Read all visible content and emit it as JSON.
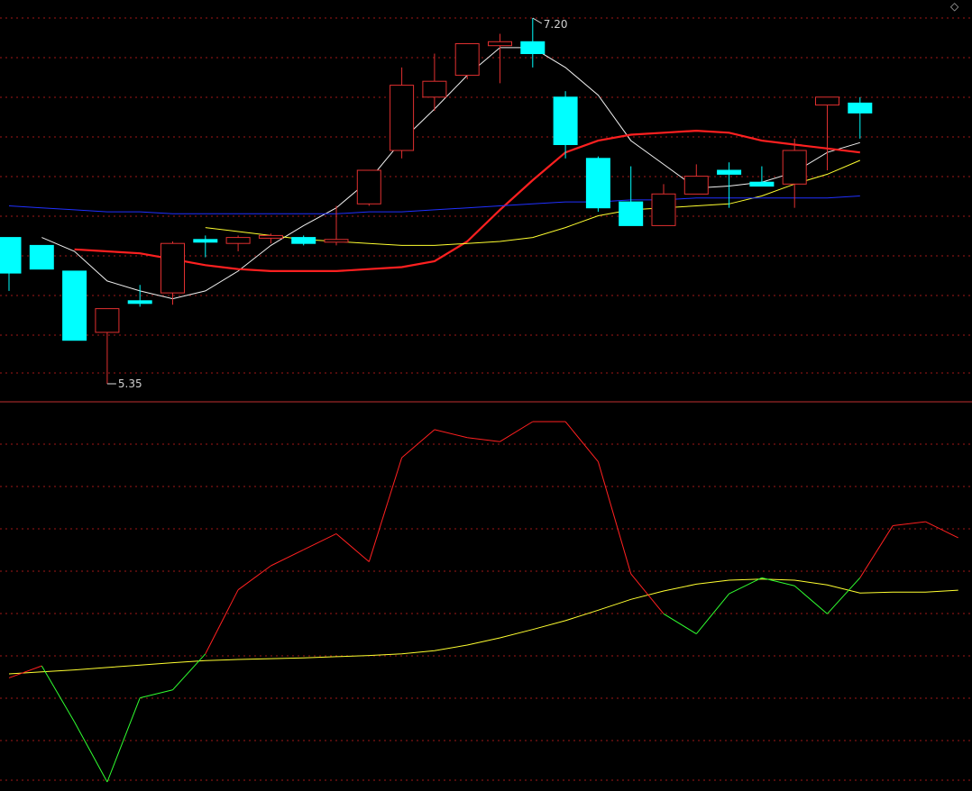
{
  "chart_data": [
    {
      "type": "candlestick",
      "ylim": [
        5.22,
        7.26
      ],
      "high_label": "7.20",
      "low_label": "5.35",
      "high_index": 16,
      "low_index": 3,
      "colors": {
        "up": "#e03030",
        "down": "#00ffff",
        "grid": "#a01818"
      },
      "candles": [
        {
          "o": 6.09,
          "h": 6.09,
          "l": 5.82,
          "c": 5.91
        },
        {
          "o": 6.05,
          "h": 6.05,
          "l": 5.93,
          "c": 5.93
        },
        {
          "o": 5.92,
          "h": 5.92,
          "l": 5.57,
          "c": 5.57
        },
        {
          "o": 5.61,
          "h": 5.63,
          "l": 5.35,
          "c": 5.73
        },
        {
          "o": 5.77,
          "h": 5.85,
          "l": 5.74,
          "c": 5.76
        },
        {
          "o": 5.81,
          "h": 6.07,
          "l": 5.75,
          "c": 6.06
        },
        {
          "o": 6.08,
          "h": 6.1,
          "l": 5.99,
          "c": 6.07
        },
        {
          "o": 6.06,
          "h": 6.1,
          "l": 6.02,
          "c": 6.09
        },
        {
          "o": 6.1,
          "h": 6.11,
          "l": 6.06,
          "c": 6.1
        },
        {
          "o": 6.09,
          "h": 6.1,
          "l": 6.05,
          "c": 6.06
        },
        {
          "o": 6.07,
          "h": 6.25,
          "l": 6.05,
          "c": 6.08
        },
        {
          "o": 6.26,
          "h": 6.43,
          "l": 6.25,
          "c": 6.43
        },
        {
          "o": 6.53,
          "h": 6.95,
          "l": 6.49,
          "c": 6.86
        },
        {
          "o": 6.8,
          "h": 7.02,
          "l": 6.73,
          "c": 6.88
        },
        {
          "o": 6.91,
          "h": 7.05,
          "l": 6.89,
          "c": 7.07
        },
        {
          "o": 7.06,
          "h": 7.12,
          "l": 6.87,
          "c": 7.08
        },
        {
          "o": 7.08,
          "h": 7.2,
          "l": 6.95,
          "c": 7.02
        },
        {
          "o": 6.8,
          "h": 6.83,
          "l": 6.49,
          "c": 6.56
        },
        {
          "o": 6.49,
          "h": 6.5,
          "l": 6.22,
          "c": 6.24
        },
        {
          "o": 6.27,
          "h": 6.45,
          "l": 6.15,
          "c": 6.15
        },
        {
          "o": 6.15,
          "h": 6.36,
          "l": 6.15,
          "c": 6.31
        },
        {
          "o": 6.31,
          "h": 6.46,
          "l": 6.31,
          "c": 6.4
        },
        {
          "o": 6.43,
          "h": 6.47,
          "l": 6.24,
          "c": 6.41
        },
        {
          "o": 6.37,
          "h": 6.45,
          "l": 6.37,
          "c": 6.35
        },
        {
          "o": 6.36,
          "h": 6.59,
          "l": 6.24,
          "c": 6.53
        },
        {
          "o": 6.76,
          "h": 6.75,
          "l": 6.43,
          "c": 6.8
        },
        {
          "o": 6.77,
          "h": 6.8,
          "l": 6.59,
          "c": 6.72
        }
      ],
      "series": [
        {
          "color": "#f0f0f0",
          "values": [
            6.09,
            6.02,
            5.87,
            5.82,
            5.78,
            5.82,
            5.92,
            6.05,
            6.15,
            6.24,
            6.38,
            6.58,
            6.74,
            6.91,
            7.05,
            7.05,
            6.95,
            6.81,
            6.58,
            6.46,
            6.34,
            6.35,
            6.37,
            6.42,
            6.52,
            6.57
          ]
        },
        {
          "color": "#ff2020",
          "values": [
            6.03,
            6.02,
            6.01,
            5.98,
            5.95,
            5.93,
            5.92,
            5.92,
            5.92,
            5.93,
            5.94,
            5.97,
            6.07,
            6.23,
            6.38,
            6.52,
            6.58,
            6.61,
            6.62,
            6.63,
            6.62,
            6.58,
            6.56,
            6.54,
            6.52
          ]
        },
        {
          "color": "#ffff30",
          "values": [
            6.14,
            6.12,
            6.1,
            6.08,
            6.07,
            6.06,
            6.05,
            6.05,
            6.06,
            6.07,
            6.09,
            6.14,
            6.2,
            6.23,
            6.24,
            6.25,
            6.26,
            6.3,
            6.36,
            6.41,
            6.48
          ]
        },
        {
          "color": "#2030ff",
          "values": [
            6.25,
            6.24,
            6.23,
            6.22,
            6.22,
            6.21,
            6.21,
            6.21,
            6.21,
            6.21,
            6.21,
            6.22,
            6.22,
            6.23,
            6.24,
            6.25,
            6.26,
            6.27,
            6.27,
            6.28,
            6.28,
            6.29,
            6.29,
            6.29,
            6.29,
            6.29,
            6.3
          ]
        }
      ]
    },
    {
      "type": "line",
      "ylim": [
        0,
        100
      ],
      "colors": {
        "above": "#ff2020",
        "below": "#30ff30",
        "signal": "#ffff30",
        "grid": "#a01818"
      },
      "indicator": [
        32,
        35,
        21,
        6,
        27,
        29,
        38,
        54,
        60,
        64,
        68,
        61,
        87,
        94,
        92,
        91,
        96,
        96,
        86,
        58,
        48,
        43,
        53,
        57,
        55,
        48,
        57,
        70,
        71,
        67
      ],
      "signal": [
        33,
        33.5,
        34,
        34.6,
        35.2,
        35.8,
        36.3,
        36.6,
        36.8,
        37,
        37.3,
        37.6,
        38,
        38.8,
        40.2,
        42,
        44.1,
        46.3,
        48.9,
        51.6,
        53.7,
        55.4,
        56.4,
        56.7,
        56.4,
        55.2,
        53.2,
        53.4,
        53.4,
        53.9
      ]
    }
  ]
}
